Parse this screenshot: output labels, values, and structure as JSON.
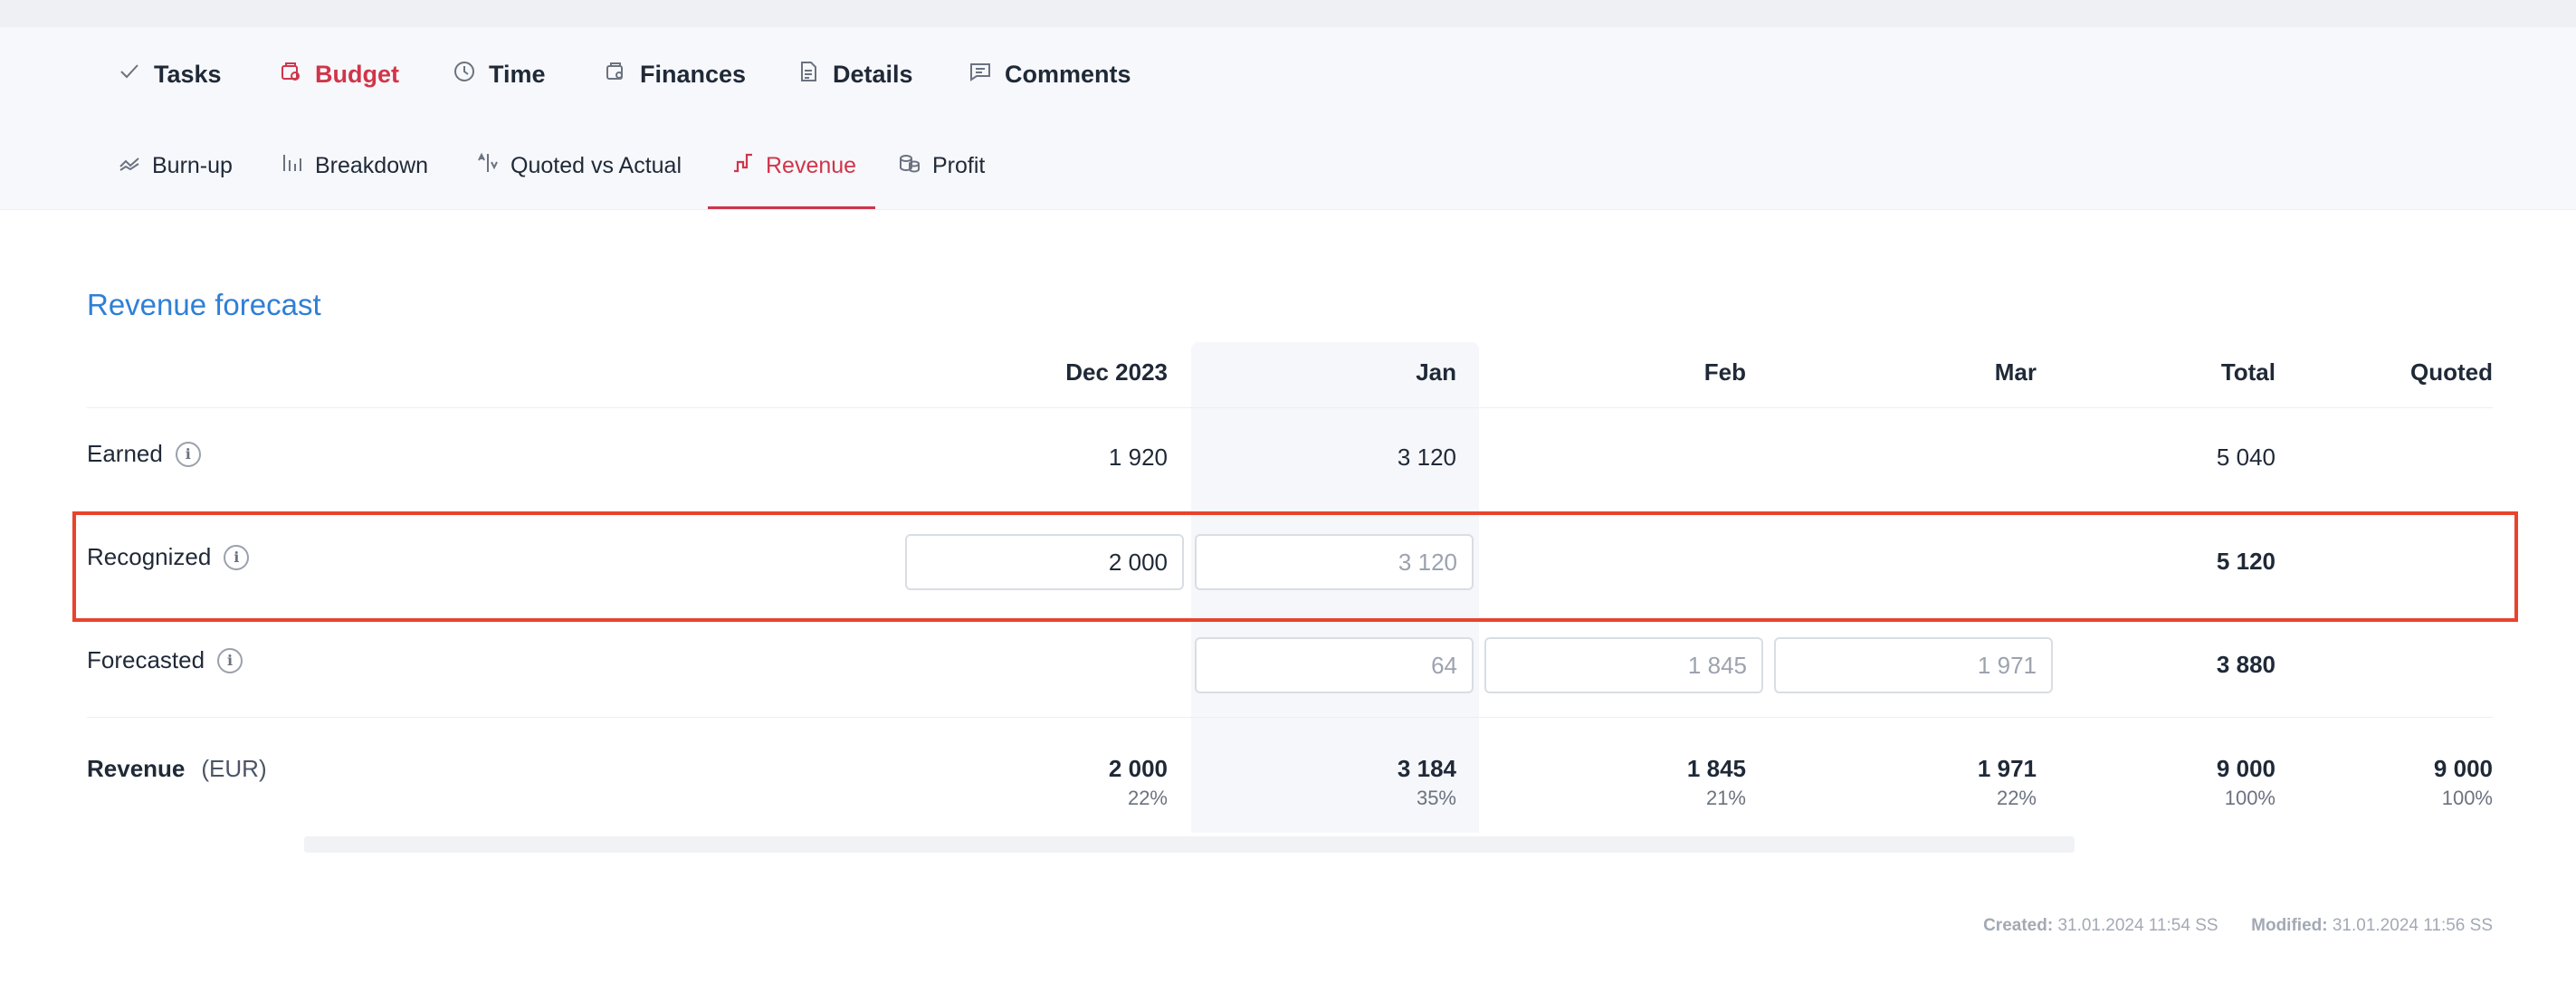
{
  "tabs": [
    {
      "label": "Tasks",
      "icon": "check-icon"
    },
    {
      "label": "Budget",
      "icon": "budget-icon",
      "active": true
    },
    {
      "label": "Time",
      "icon": "clock-icon"
    },
    {
      "label": "Finances",
      "icon": "finances-icon"
    },
    {
      "label": "Details",
      "icon": "document-icon"
    },
    {
      "label": "Comments",
      "icon": "comment-icon"
    }
  ],
  "subtabs": [
    {
      "label": "Burn-up",
      "icon": "burn-up-icon"
    },
    {
      "label": "Breakdown",
      "icon": "bar-chart-icon"
    },
    {
      "label": "Quoted vs Actual",
      "icon": "compare-icon"
    },
    {
      "label": "Revenue",
      "icon": "revenue-icon",
      "active": true
    },
    {
      "label": "Profit",
      "icon": "coins-icon"
    }
  ],
  "section_title": "Revenue forecast",
  "table": {
    "columns": [
      "Dec 2023",
      "Jan",
      "Feb",
      "Mar",
      "Total",
      "Quoted"
    ],
    "earned": {
      "label": "Earned",
      "dec": "1 920",
      "jan": "3 120",
      "total": "5 040"
    },
    "recognized": {
      "label": "Recognized",
      "dec_value": "2 000",
      "jan_placeholder": "3 120",
      "total": "5 120"
    },
    "forecasted": {
      "label": "Forecasted",
      "jan_placeholder": "64",
      "feb_placeholder": "1 845",
      "mar_placeholder": "1 971",
      "total": "3 880"
    },
    "revenue": {
      "label": "Revenue",
      "unit": "(EUR)",
      "dec": "2 000",
      "dec_pct": "22%",
      "jan": "3 184",
      "jan_pct": "35%",
      "feb": "1 845",
      "feb_pct": "21%",
      "mar": "1 971",
      "mar_pct": "22%",
      "total": "9 000",
      "total_pct": "100%",
      "quoted": "9 000",
      "quoted_pct": "100%"
    }
  },
  "footer": {
    "created_label": "Created:",
    "created_value": "31.01.2024 11:54 SS",
    "modified_label": "Modified:",
    "modified_value": "31.01.2024 11:56 SS"
  },
  "colors": {
    "accent_red": "#d0354a",
    "title_blue": "#2f7fd6",
    "highlight_box": "#e8432c"
  }
}
